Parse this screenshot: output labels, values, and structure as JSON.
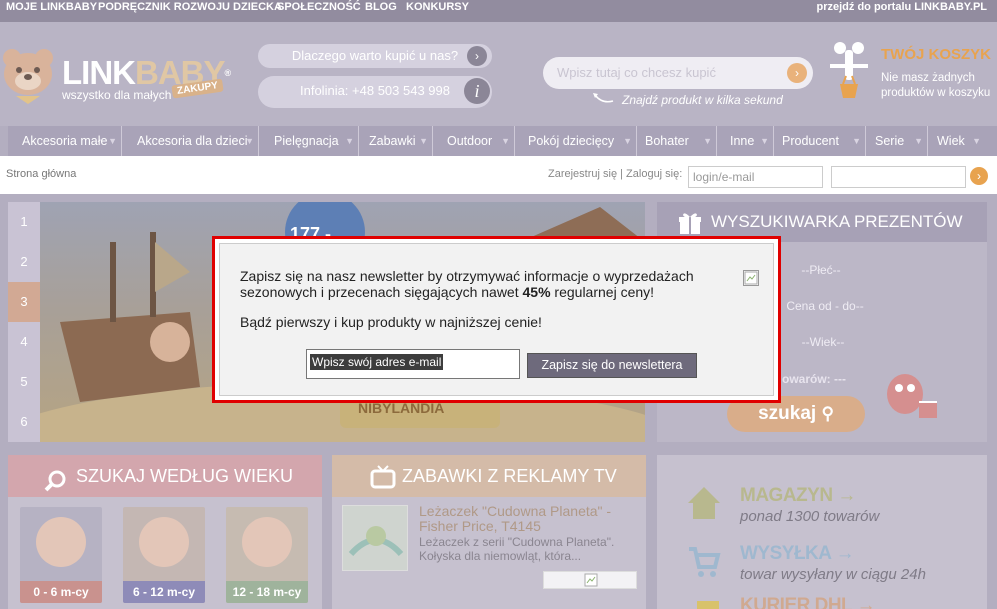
{
  "topbar": {
    "links": [
      "MOJE LINKBABY",
      "PODRĘCZNIK ROZWOJU DZIECKA",
      "SPOŁECZNOŚĆ",
      "BLOG",
      "KONKURSY"
    ],
    "portal_link": "przejdź do portalu LINKBABY.PL"
  },
  "brand": {
    "name_a": "LINK",
    "name_b": "BABY",
    "tagline": "wszystko dla małych",
    "tag": "ZAKUPY",
    "reg": "®"
  },
  "header": {
    "why_label": "Dlaczego warto kupić u nas?",
    "hotline_label": "Infolinia: +48 503 543 998",
    "info_glyph": "i",
    "search_placeholder": "Wpisz tutaj co chcesz kupić",
    "search_hint": "Znajdź produkt w kilka sekund",
    "cart_title": "TWÓJ KOSZYK",
    "cart_status": "Nie masz żadnych produktów w koszyku"
  },
  "nav": {
    "categories": [
      "Akcesoria małe",
      "Akcesoria dla dzieci",
      "Pielęgnacja",
      "Zabawki",
      "Outdoor",
      "Pokój dziecięcy",
      "Bohater",
      "Inne",
      "Producent",
      "Serie",
      "Wiek"
    ]
  },
  "breadcrumb": "Strona główna",
  "login": {
    "prompt": "Zarejestruj się | Zaloguj się:",
    "login_placeholder": "login/e-mail"
  },
  "slider": {
    "numbers": [
      "1",
      "2",
      "3",
      "4",
      "5",
      "6"
    ],
    "active": "3",
    "banner_badge": "177,-",
    "banner_sign": "NIBYLANDIA"
  },
  "gift_finder": {
    "title": "WYSZUKIWARKA PREZENTÓW",
    "gender": "--Płeć--",
    "price": "Cena od - do--",
    "age": "--Wiek--",
    "count_label": "owarów: ---",
    "search_button": "szukaj"
  },
  "age_box": {
    "title": "SZUKAJ WEDŁUG WIEKU",
    "items": [
      "0 - 6 m-cy",
      "6 - 12 m-cy",
      "12 - 18 m-cy"
    ]
  },
  "tv_box": {
    "title": "ZABAWKI Z REKLAMY TV",
    "product_title": "Leżaczek \"Cudowna Planeta\" - Fisher Price, T4145",
    "product_desc": "Leżaczek z serii \"Cudowna Planeta\". Kołyska dla niemowląt, która..."
  },
  "info_box": {
    "items": [
      {
        "title": "MAGAZYN",
        "sub": "ponad 1300 towarów"
      },
      {
        "title": "WYSYŁKA",
        "sub": "towar wysyłany w ciągu 24h"
      },
      {
        "title": "KURIER DHL",
        "sub": ""
      }
    ]
  },
  "popup": {
    "line1": "Zapisz się na nasz newsletter by otrzymywać informacje o wyprzedażach",
    "line2_a": "sezonowych i przecenach sięgających nawet ",
    "line2_b": "45%",
    "line2_c": " regularnej ceny!",
    "line3": "Bądź pierwszy i kup produkty w najniższej cenie!",
    "email_value": "Wpisz swój adres e-mail",
    "subscribe_button": "Zapisz się do newslettera"
  },
  "colors": {
    "accent_orange": "#e8a34f",
    "overlay_lilac": "#b3aec0",
    "popup_border": "#e00000"
  }
}
